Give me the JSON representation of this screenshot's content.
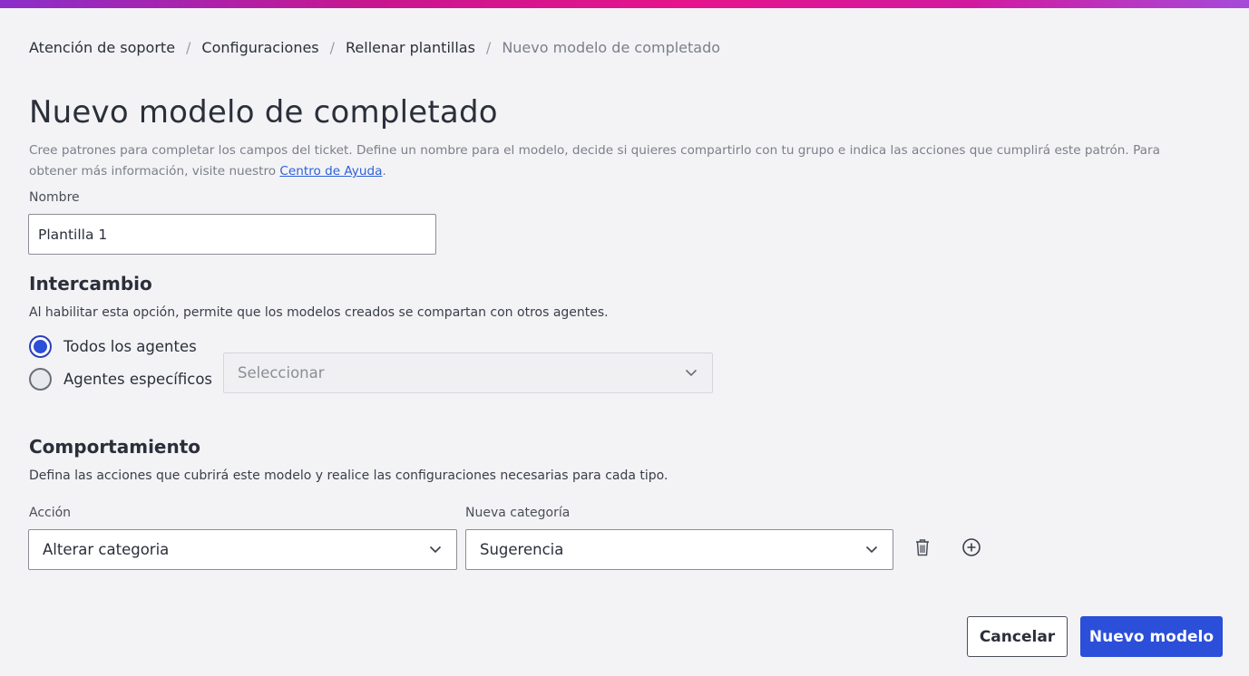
{
  "breadcrumb": [
    {
      "label": "Atención de soporte"
    },
    {
      "label": "Configuraciones"
    },
    {
      "label": "Rellenar plantillas"
    },
    {
      "label": "Nuevo modelo de completado"
    }
  ],
  "breadcrumb_separator": "/",
  "page": {
    "title": "Nuevo modelo de completado",
    "description": "Cree patrones para completar los campos del ticket. Define un nombre para el modelo, decide si quieres compartirlo con tu grupo e indica las acciones que cumplirá este patrón. Para obtener más información, visite nuestro ",
    "help_link": "Centro de Ayuda",
    "description_end": "."
  },
  "name_field": {
    "label": "Nombre",
    "value": "Plantilla 1"
  },
  "sharing": {
    "title": "Intercambio",
    "description": "Al habilitar esta opción, permite que los modelos creados se compartan con otros agentes.",
    "options": [
      {
        "label": "Todos los agentes",
        "checked": true
      },
      {
        "label": "Agentes específicos",
        "checked": false
      }
    ],
    "agents_select_placeholder": "Seleccionar"
  },
  "behavior": {
    "title": "Comportamiento",
    "description": "Defina las acciones que cubrirá este modelo y realice las configuraciones necesarias para cada tipo.",
    "action_label": "Acción",
    "action_value": "Alterar categoria",
    "category_label": "Nueva categoría",
    "category_value": "Sugerencia"
  },
  "footer": {
    "cancel_label": "Cancelar",
    "submit_label": "Nuevo modelo"
  },
  "icons": {
    "chevron": "chevron-down-icon",
    "delete": "trash-icon",
    "add": "plus-circle-icon"
  },
  "colors": {
    "primary": "#2b4fd9",
    "link": "#2f5fd9",
    "background": "#f3f3f6"
  }
}
